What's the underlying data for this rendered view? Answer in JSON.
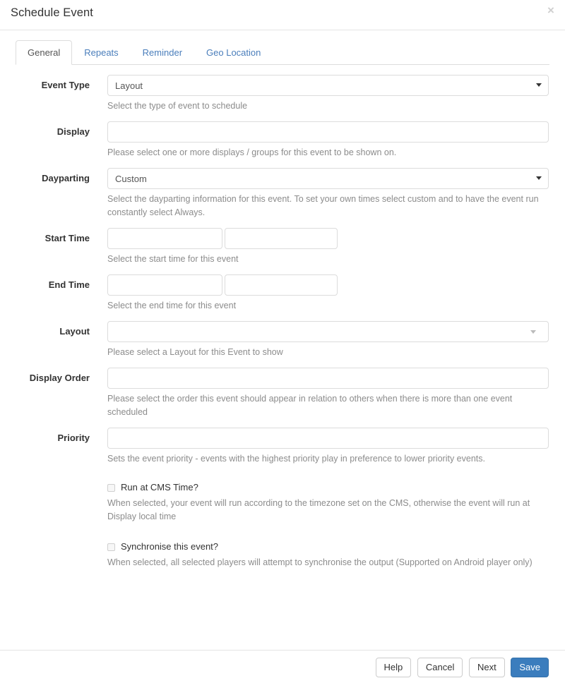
{
  "header": {
    "title": "Schedule Event",
    "close_label": "×"
  },
  "tabs": [
    {
      "label": "General",
      "active": true
    },
    {
      "label": "Repeats",
      "active": false
    },
    {
      "label": "Reminder",
      "active": false
    },
    {
      "label": "Geo Location",
      "active": false
    }
  ],
  "form": {
    "event_type": {
      "label": "Event Type",
      "value": "Layout",
      "help": "Select the type of event to schedule",
      "caret_icon": "chevron-down-icon"
    },
    "display": {
      "label": "Display",
      "value": "",
      "placeholder": "",
      "help": "Please select one or more displays / groups for this event to be shown on."
    },
    "dayparting": {
      "label": "Dayparting",
      "value": "Custom",
      "help": "Select the dayparting information for this event. To set your own times select custom and to have the event run constantly select Always.",
      "caret_icon": "chevron-down-icon"
    },
    "start_time": {
      "label": "Start Time",
      "date_value": "",
      "time_value": "",
      "help": "Select the start time for this event"
    },
    "end_time": {
      "label": "End Time",
      "date_value": "",
      "time_value": "",
      "help": "Select the end time for this event"
    },
    "layout": {
      "label": "Layout",
      "value": "",
      "help": "Please select a Layout for this Event to show",
      "caret_icon": "chevron-down-icon"
    },
    "display_order": {
      "label": "Display Order",
      "value": "",
      "help": "Please select the order this event should appear in relation to others when there is more than one event scheduled"
    },
    "priority": {
      "label": "Priority",
      "value": "",
      "help": "Sets the event priority - events with the highest priority play in preference to lower priority events."
    },
    "run_at_cms_time": {
      "label": "Run at CMS Time?",
      "checked": false,
      "help": "When selected, your event will run according to the timezone set on the CMS, otherwise the event will run at Display local time"
    },
    "synchronise": {
      "label": "Synchronise this event?",
      "checked": false,
      "help": "When selected, all selected players will attempt to synchronise the output (Supported on Android player only)"
    }
  },
  "footer": {
    "help_label": "Help",
    "cancel_label": "Cancel",
    "next_label": "Next",
    "save_label": "Save"
  },
  "colors": {
    "primary": "#3b7dbd",
    "link": "#4a7ebb",
    "border": "#dcdcdc",
    "help_text": "#8c8c8c"
  }
}
